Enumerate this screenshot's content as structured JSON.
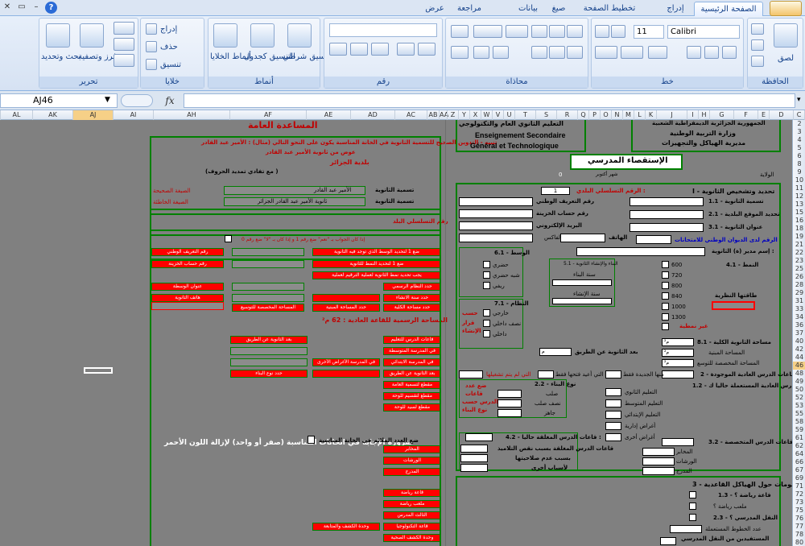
{
  "ribbon": {
    "tabs": [
      "الصفحة الرئيسية",
      "إدراج",
      "تخطيط الصفحة",
      "صيغ",
      "بيانات",
      "مراجعة",
      "عرض"
    ],
    "groups": {
      "clipboard": {
        "label": "الحافظة",
        "paste": "لصق"
      },
      "font": {
        "label": "خط",
        "font_name": "Calibri",
        "font_size": "11"
      },
      "alignment": {
        "label": "محاذاة"
      },
      "number": {
        "label": "رقم"
      },
      "styles": {
        "label": "أنماط",
        "conditional": "تنسيق شرطي",
        "table": "التنسيق كجدول",
        "cell_styles": "أنماط الخلايا"
      },
      "cells": {
        "label": "خلايا",
        "insert": "إدراج",
        "delete": "حذف",
        "format": "تنسيق"
      },
      "editing": {
        "label": "تحرير",
        "sort": "فرز وتصفية",
        "find": "بحث وتحديد"
      }
    }
  },
  "formula_bar": {
    "name_box": "AJ46",
    "fx": "fx"
  },
  "columns": [
    "AL",
    "AK",
    "AJ",
    "AI",
    "AH",
    "AF",
    "AE",
    "AD",
    "AC",
    "AB",
    "AA",
    "Z",
    "Y",
    "X",
    "W",
    "V",
    "U",
    "T",
    "S",
    "R",
    "Q",
    "P",
    "O",
    "N",
    "M",
    "L",
    "K",
    "J",
    "I",
    "H",
    "G",
    "F",
    "E",
    "D",
    "C",
    "B",
    "A"
  ],
  "rows": [
    "2",
    "3",
    "4",
    "5",
    "6",
    "8",
    "9",
    "10",
    "11",
    "12",
    "13",
    "15",
    "16",
    "18",
    "19",
    "21",
    "22",
    "23",
    "25",
    "26",
    "28",
    "29",
    "31",
    "33",
    "34",
    "36",
    "37",
    "40",
    "42",
    "44",
    "46",
    "48",
    "49",
    "50",
    "52",
    "53",
    "55",
    "58",
    "59",
    "61",
    "62",
    "64",
    "66",
    "67",
    "69",
    "71",
    "72",
    "73",
    "75",
    "76",
    "77",
    "78",
    "80"
  ],
  "sheet": {
    "left": {
      "title": "المساعدة العامة",
      "note": "تنبيه - التدوين الصحيح للتسمية الثانوية في الخانة المناسبة يكون على النحو التالي (مثال) : الأمير عبد القادر",
      "example_1": "عوض من ثانوية الأمير عبد القادر",
      "example_2": "بلدية الجزائر",
      "example_3": "(مع تفادي تمديد الحروف )",
      "correct": "الصيغة الصحيحة",
      "wrong": "الصيغة الخاطئة",
      "naming_1": "تسمية الثانوية",
      "naming_2": "تسمية الثانوية",
      "val_1": "الأمير عبد القادر",
      "val_2": "ثانوية الأمير عبد القادر الجزائر",
      "serial": "رقم التسلسلي البلد",
      "red_cells": [
        "رقم التعريف الوطني",
        "رقم حساب الخزينة",
        "عنوان الوسطة",
        "هاتف الثانوية",
        "المساحة المخصصة للتوسيع"
      ],
      "note_small": "إذا كان الجواب بـ \"نعم\" ضع رقم 1 و إذا كان بـ \"لا\" ضع رقم 0",
      "left_items": [
        "ضع 1 لتحديد الوسط الذي توجد فيه الثانوية",
        "ضع 1 لتحديد النمط للثانوية",
        "يجب تحديد نمط الثانوية لعملية الترقيم لعملية",
        "حدد النظام الرسمي",
        "حدد سنة الانشاء",
        "حدد المساحة المبنية",
        "حدد مساحة الكلية"
      ],
      "area_title": "المساحة الرسمية للقاعة العادية : 62 م²",
      "mid_items": [
        "قاعات الدرس للتعليم",
        "في المدرسة المتوسطة",
        "في المدرسة الابتدائي",
        "في المدرسة الأغراض الأخرى",
        "بعد الثانوية عن الطريق"
      ],
      "mid_items_2": [
        "بعد الثانوية عن الطريق",
        "حدد نوع البناء"
      ],
      "bottom_items": [
        "مقطع لتسمية العامة",
        "مقطع لتقسيم للوحة",
        "مقطع لسيد للوحة"
      ],
      "necessity": "ضرورة الإجابة في الخانات المناسبة (صفر أو واحد) لإزالة اللون الأحمر",
      "put_sign": "ضع العدد الملائم في الخانة المناسبة",
      "sign_items": [
        "المخابر",
        "الورشات",
        "المدرج"
      ],
      "last_items": [
        "قاعة رياضة",
        "ملعب رياضة",
        "الثالث المدرس",
        "قاعة التكنولوجيا",
        "وحدة الكشف والمتابعة",
        "وحدة الكشف الصحية"
      ]
    },
    "right": {
      "header_1": "التعليم الثانوي العام والتكنولوجي",
      "header_fr_1": "Enseignement Secondaire",
      "header_fr_2": "Général et Technologique",
      "header_r1": "الجمهورية الجزائرية الديمقراطية الشعبية",
      "header_r2": "وزارة التربية الوطنية",
      "header_r3": "مديرية الهياكل والتجهيزات",
      "survey_title": "الإستقصاء المدرسي",
      "month": "شهر أكتوبر",
      "state": "الولاية",
      "zero": "0",
      "section_1": "I - تحديد وتشخيص الثانوية",
      "serial_label": "الرقم التسلسلي البلدي :",
      "serial_val": "1",
      "items_1": [
        "1.1 - تسمية الثانوية",
        "2.1 - تحديد الموقع البلدية",
        "3.1 - عنوان الثانوية"
      ],
      "national_id": "رقم التعريف الوطني",
      "treasury": "رقم حساب الخزينة",
      "email": "البريد الإلكتروني",
      "fax": "الفاكس",
      "phone": "الهاتف",
      "exams": "الرقم لدى الديوان الوطني للامتحانات",
      "director": "إسم مدير (ة) الثانوية :",
      "sec_61": "6.1 - الوسط",
      "urban": "حضري",
      "semi": "شبه حضري",
      "rural": "ريفي",
      "sec_51": "5.1 - البناء والإنشاء الثانوية",
      "build_year": "سنة البناء",
      "create_year": "سنة الإنشاء",
      "sec_41": "4.1 - النمط",
      "patterns": [
        "600",
        "720",
        "800",
        "840",
        "1000",
        "1300"
      ],
      "capacity": "طاقتها النظرية",
      "nonstd": "غير نمطية",
      "sec_71": "7.1 - النظام",
      "regimes": [
        "خارجي",
        "نصف داخلي",
        "داخلي"
      ],
      "red_labels": [
        "حسب",
        "قرار",
        "الإنشاء"
      ],
      "road_dist": "بعد الثانوية عن الطريق",
      "road_unit": "م",
      "area_items": [
        "8.1 - مساحة الثانوية الكلية",
        "المساحة المبنية",
        "المساحة المخصصة للتوسع"
      ],
      "sq": "م²",
      "sec_2": "2 - القاعات الدرس العادية الموجودة",
      "new_only": "منها الجديدة فقط",
      "used_from": "التي أعيد فتحها فقط",
      "not_used": "التي لم يتم تشغيلها",
      "sec_12": "1.2 - قاعات الدرس العادية المستعملة حاليا ك :",
      "uses": [
        "التعليم الثانوي",
        "التعليم المتوسط",
        "التعليم الإبتدائي",
        "أغراض إدارية",
        "أغراض أخرى"
      ],
      "sec_22": "2.2 - نوع البناء",
      "types": [
        "صلب",
        "نصف صلب",
        "جاهز"
      ],
      "red_cols": [
        "ضع عدد",
        "قاعات",
        "الدرس حسب",
        "نوع البناء"
      ],
      "sec_42": "4.2 - قاعات الدرس المغلقة حاليا :",
      "closed": [
        "قاعات الدرس المغلقة بسبب نقص التلاميذ",
        "بسبب عدم صلاحيتها",
        "لأسباب أخرى"
      ],
      "sec_32": "3.2 - قاعات الدرس المتخصصة",
      "specialized": [
        "المخابر",
        "الورشات",
        "المدرج"
      ],
      "sec_3": "3 - معلومات حول الهياكل القاعدية",
      "sec_13": "1.3 - قاعة رياضة ؟",
      "playground": "ملعب رياضة ؟",
      "sec_23": "2.3 - النقل المدرسي ؟",
      "lines": "عدد الخطوط المستعملة",
      "beneficiaries": "المستفيدين من النقل المدرسي"
    }
  },
  "colors": {
    "accent": "#15428b",
    "sheet_bg": "#808080",
    "green": "#008000",
    "red": "#ff0000"
  }
}
